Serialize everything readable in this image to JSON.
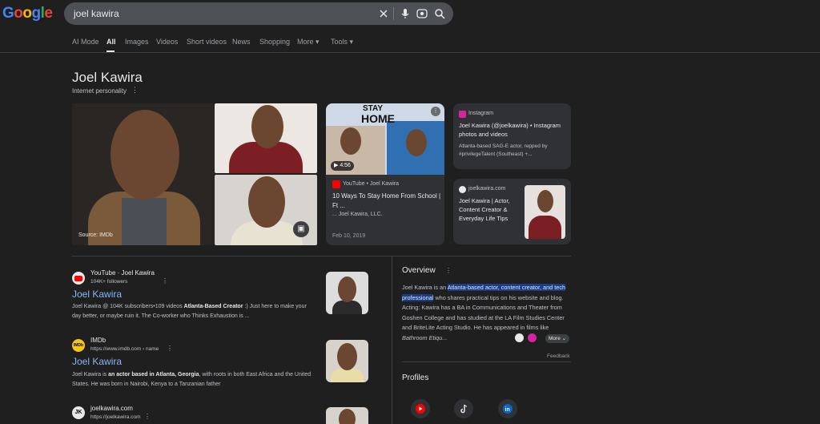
{
  "colors": {
    "bg": "#1f1f1f",
    "link": "#8ab4f8",
    "panel": "#303134"
  },
  "search": {
    "query": "joel kawira"
  },
  "tabs": [
    {
      "label": "AI Mode"
    },
    {
      "label": "All"
    },
    {
      "label": "Images"
    },
    {
      "label": "Videos"
    },
    {
      "label": "Short videos"
    },
    {
      "label": "News"
    },
    {
      "label": "Shopping"
    },
    {
      "label": "More ▾"
    },
    {
      "label": "Tools ▾"
    }
  ],
  "kp": {
    "title": "Joel Kawira",
    "subtitle": "Internet personality",
    "image_source": "Source: IMDb"
  },
  "video_card": {
    "thumb_text_1": "STAY",
    "thumb_text_2": "HOME",
    "duration": "4:56",
    "source": "YouTube • Joel Kawira",
    "title": "10 Ways To Stay Home From School | Ft ...",
    "byline": "... Joel Kawira, LLC.",
    "date": "Feb 10, 2019"
  },
  "insta_card": {
    "source": "Instagram",
    "title": "Joel Kawira (@joelkawira) • Instagram photos and videos",
    "snippet": "Atlanta-based SAG-E actor, repped by #privilegeTalent (Southeast) +..."
  },
  "site_card": {
    "source": "joelkawira.com",
    "title": "Joel Kawira | Actor, Content Creator & Everyday Life Tips"
  },
  "results": [
    {
      "site": "YouTube · Joel Kawira",
      "url": "104K+ followers",
      "title": "Joel Kawira",
      "snippet_pre": "Joel Kawira @ 104K subscribers•109 videos ",
      "snippet_bold": "Atlanta-Based Creator",
      "snippet_post": " :) Just here to make your day better, or maybe ruin it. The Co-worker who Thinks Exhaustion is ..."
    },
    {
      "site": "IMDb",
      "url": "https://www.imdb.com › name",
      "title": "Joel Kawira",
      "snippet_pre": "Joel Kawira is ",
      "snippet_bold": "an actor based in Atlanta, Georgia",
      "snippet_post": ", with roots in both East Africa and the United States. He was born in Nairobi, Kenya to a Tanzanian father"
    },
    {
      "site": "joelkawira.com",
      "url": "https://joelkawira.com",
      "favicon": "JK"
    }
  ],
  "overview": {
    "heading": "Overview",
    "text_pre": "Joel Kawira is an ",
    "text_hl": "Atlanta-based actor, content creator, and tech professional",
    "text_post": " who shares practical tips on his website and blog. Acting: Kawira has a BA in Communications and Theater from Goshen College and has studied at the LA Film Studies Center and BriteLite Acting Studio. He has appeared in films like ",
    "text_italic": "Bathroom Etiqu...",
    "more": "More ⌄",
    "feedback": "Feedback"
  },
  "profiles": {
    "heading": "Profiles"
  }
}
